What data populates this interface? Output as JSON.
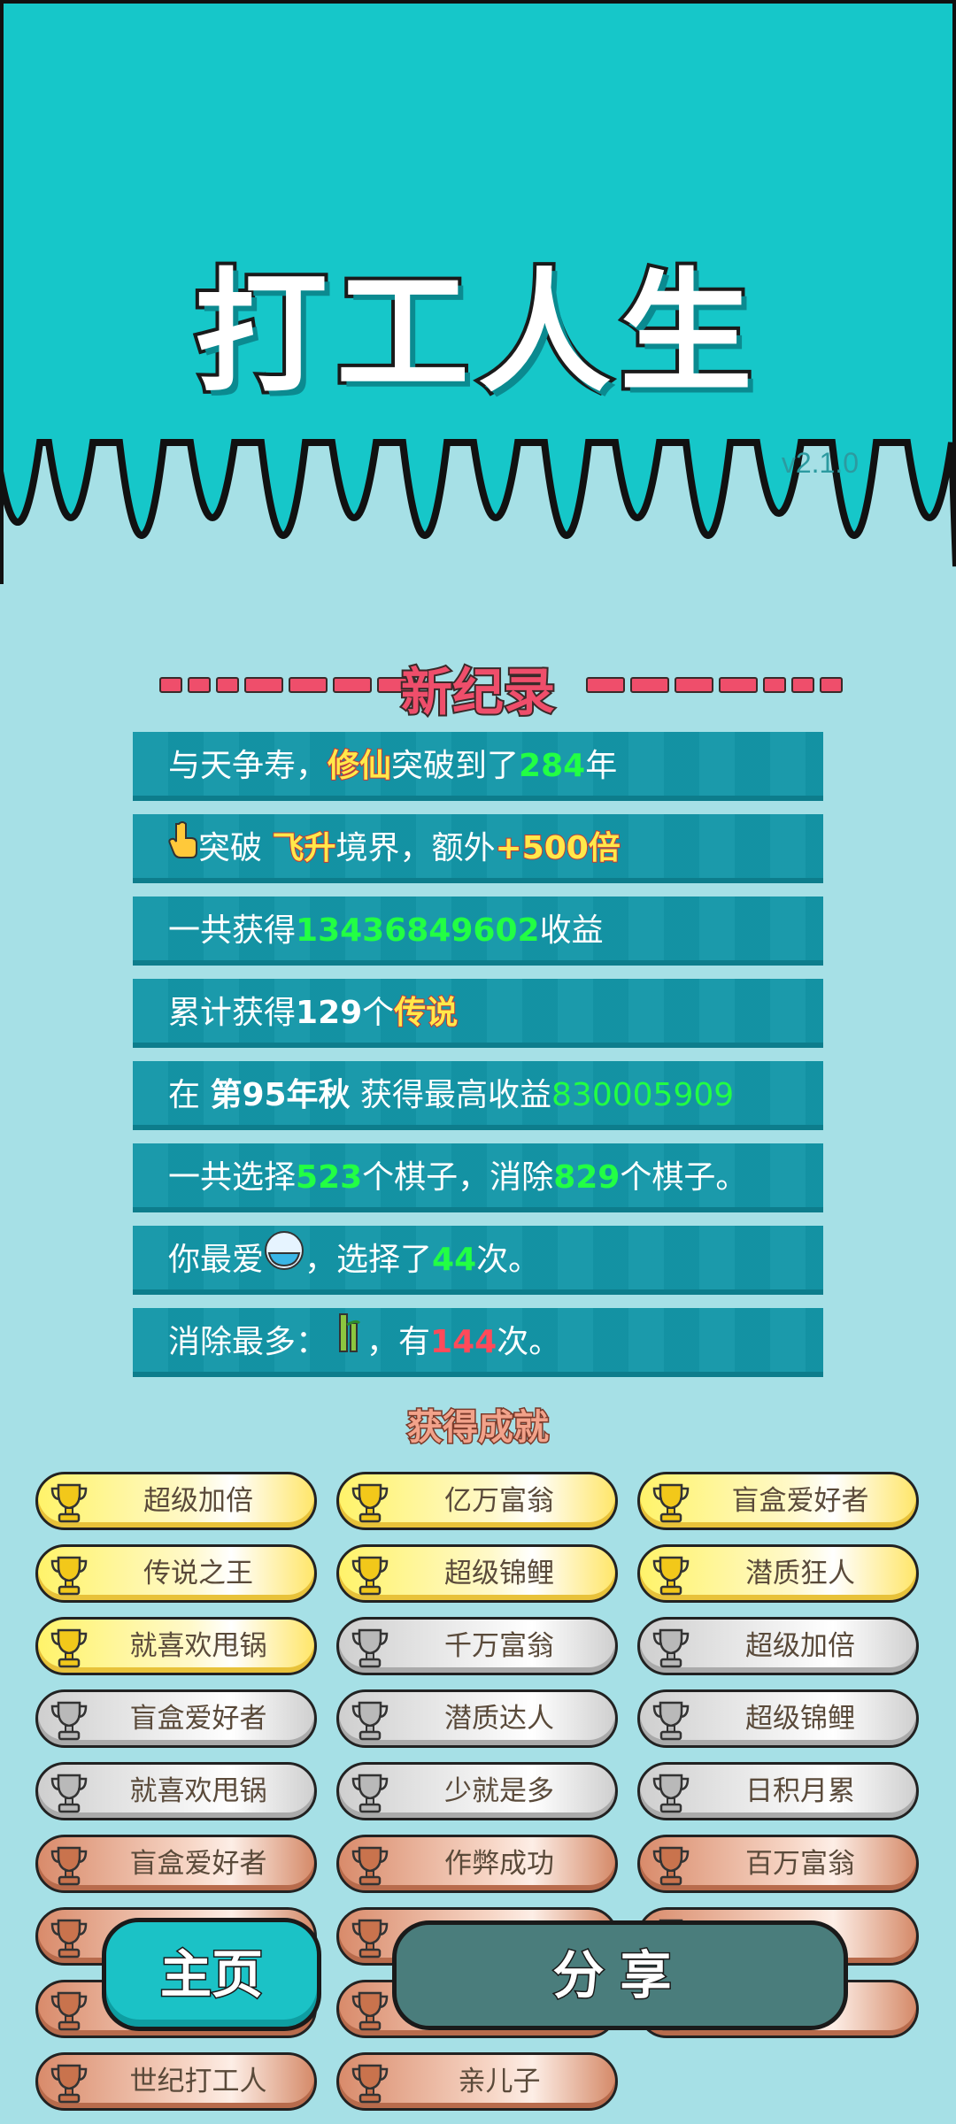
{
  "header": {
    "title": "打工人生",
    "version": "v2.1.0",
    "colors": {
      "top_bg": "#16c7c9",
      "bottom_bg": "#a6e0e6"
    }
  },
  "record": {
    "title": "新纪录",
    "stats": [
      {
        "parts": [
          [
            "t",
            "与天争寿，"
          ],
          [
            "y",
            "修仙"
          ],
          [
            "t",
            "突破到了"
          ],
          [
            "g",
            "284"
          ],
          [
            "t",
            "年"
          ]
        ]
      },
      {
        "parts": [
          [
            "icon",
            "pointing-hand-icon"
          ],
          [
            "t",
            "突破 "
          ],
          [
            "y",
            "飞升"
          ],
          [
            "t",
            "境界，额外"
          ],
          [
            "y",
            "+500倍"
          ]
        ]
      },
      {
        "parts": [
          [
            "t",
            "一共获得"
          ],
          [
            "g",
            "13436849602"
          ],
          [
            "t",
            "收益"
          ]
        ]
      },
      {
        "parts": [
          [
            "t",
            "累计获得"
          ],
          [
            "w",
            "129"
          ],
          [
            "t",
            "个"
          ],
          [
            "y",
            "传说"
          ]
        ]
      },
      {
        "parts": [
          [
            "t",
            "在 "
          ],
          [
            "w",
            "第95年秋"
          ],
          [
            "t",
            " 获得最高收益"
          ],
          [
            "gl",
            "830005909"
          ]
        ]
      },
      {
        "parts": [
          [
            "t",
            "一共选择"
          ],
          [
            "g",
            "523"
          ],
          [
            "t",
            "个棋子，消除"
          ],
          [
            "g",
            "829"
          ],
          [
            "t",
            "个棋子。"
          ]
        ]
      },
      {
        "parts": [
          [
            "t",
            "你最爱"
          ],
          [
            "icon",
            "rice-bowl-icon"
          ],
          [
            "t",
            "，选择了"
          ],
          [
            "g",
            "44"
          ],
          [
            "t",
            "次。"
          ]
        ]
      },
      {
        "parts": [
          [
            "t",
            "消除最多："
          ],
          [
            "icon",
            "bamboo-icon"
          ],
          [
            "t",
            "，有"
          ],
          [
            "r",
            "144"
          ],
          [
            "t",
            "次。"
          ]
        ]
      }
    ]
  },
  "achievements": {
    "title": "获得成就",
    "items": [
      {
        "label": "超级加倍",
        "tier": "gold"
      },
      {
        "label": "亿万富翁",
        "tier": "gold"
      },
      {
        "label": "盲盒爱好者",
        "tier": "gold"
      },
      {
        "label": "传说之王",
        "tier": "gold"
      },
      {
        "label": "超级锦鲤",
        "tier": "gold"
      },
      {
        "label": "潜质狂人",
        "tier": "gold"
      },
      {
        "label": "就喜欢甩锅",
        "tier": "gold"
      },
      {
        "label": "千万富翁",
        "tier": "silver"
      },
      {
        "label": "超级加倍",
        "tier": "silver"
      },
      {
        "label": "盲盒爱好者",
        "tier": "silver"
      },
      {
        "label": "潜质达人",
        "tier": "silver"
      },
      {
        "label": "超级锦鲤",
        "tier": "silver"
      },
      {
        "label": "就喜欢甩锅",
        "tier": "silver"
      },
      {
        "label": "少就是多",
        "tier": "silver"
      },
      {
        "label": "日积月累",
        "tier": "silver"
      },
      {
        "label": "盲盒爱好者",
        "tier": "bronze"
      },
      {
        "label": "作弊成功",
        "tier": "bronze"
      },
      {
        "label": "百万富翁",
        "tier": "bronze"
      },
      {
        "label": "",
        "tier": "bronze"
      },
      {
        "label": "",
        "tier": "bronze"
      },
      {
        "label": "锅",
        "tier": "bronze"
      },
      {
        "label": "",
        "tier": "bronze"
      },
      {
        "label": "",
        "tier": "bronze"
      },
      {
        "label": "",
        "tier": "bronze"
      },
      {
        "label": "世纪打工人",
        "tier": "bronze"
      },
      {
        "label": "亲儿子",
        "tier": "bronze"
      }
    ]
  },
  "buttons": {
    "home": "主页",
    "share": "分享"
  }
}
